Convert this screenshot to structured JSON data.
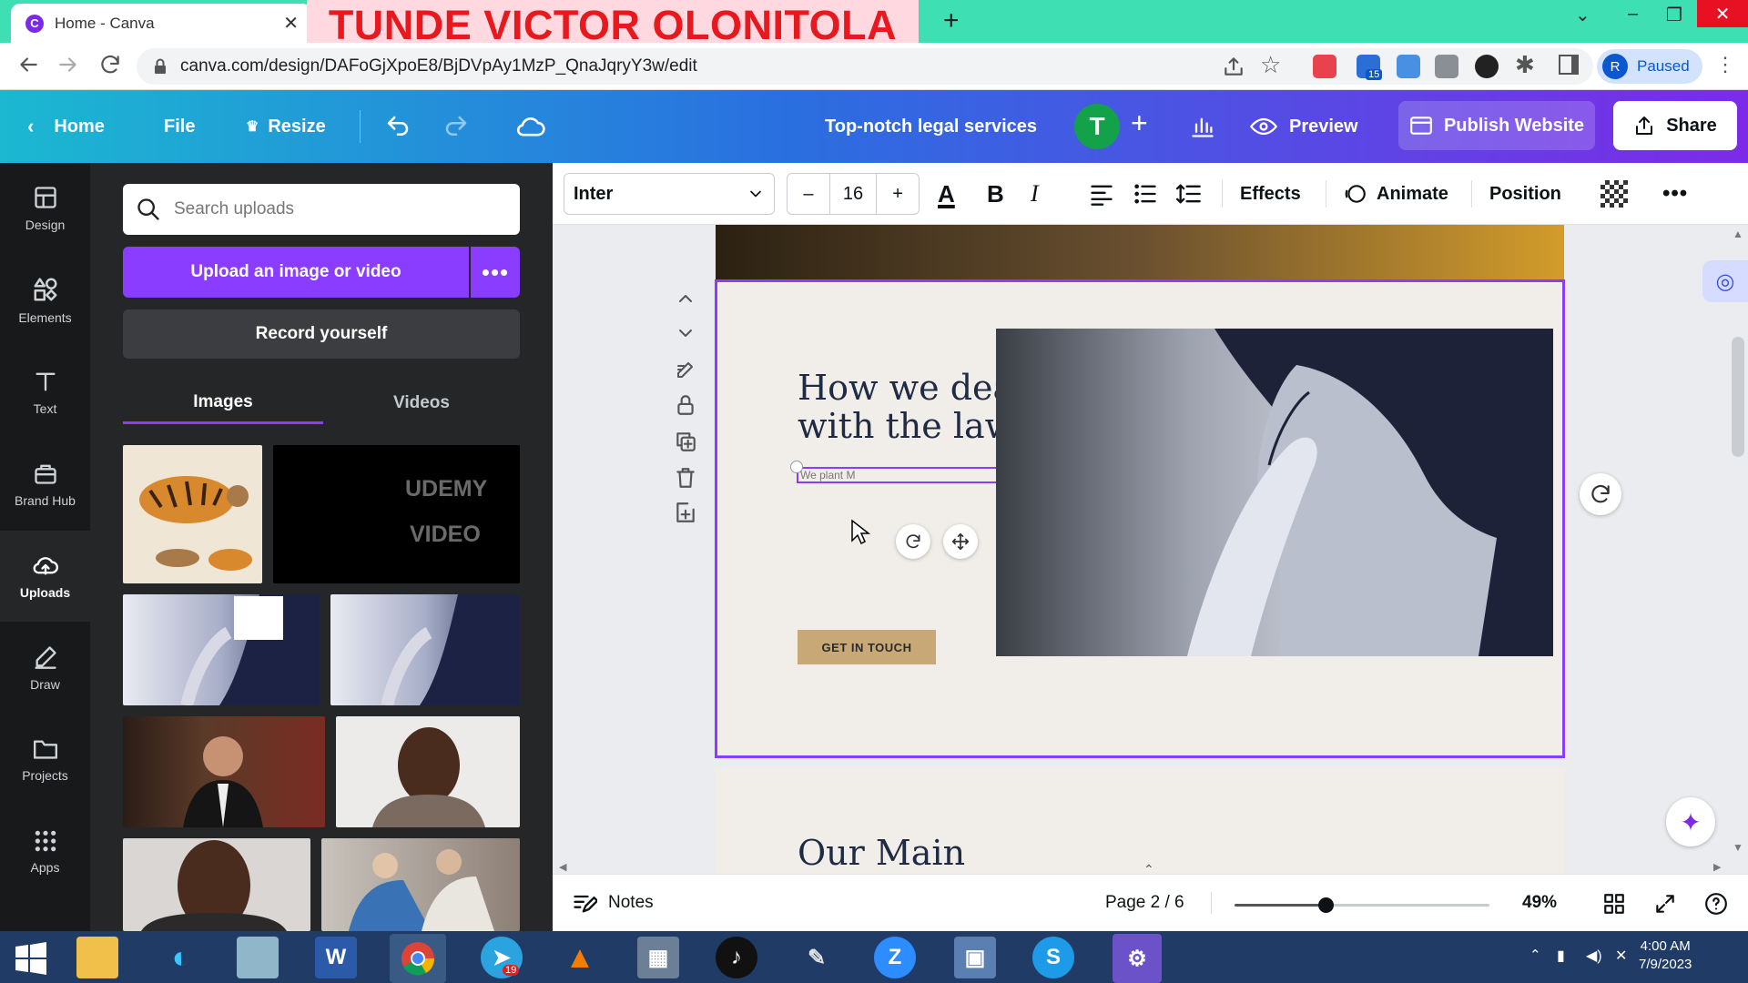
{
  "browser": {
    "tab_title": "Home - Canva",
    "overlay_text": "TUNDE VICTOR OLONITOLA",
    "url": "canva.com/design/DAFoGjXpoE8/BjDVpAy1MzP_QnaJqryY3w/edit",
    "profile_initial": "R",
    "profile_status": "Paused",
    "ext_badge": "15"
  },
  "header": {
    "home": "Home",
    "file": "File",
    "resize": "Resize",
    "design_title": "Top-notch legal services",
    "avatar_initial": "T",
    "preview": "Preview",
    "publish": "Publish Website",
    "share": "Share"
  },
  "rail": [
    {
      "label": "Design",
      "icon": "design-icon"
    },
    {
      "label": "Elements",
      "icon": "elements-icon"
    },
    {
      "label": "Text",
      "icon": "text-icon"
    },
    {
      "label": "Brand Hub",
      "icon": "brand-hub-icon"
    },
    {
      "label": "Uploads",
      "icon": "uploads-icon"
    },
    {
      "label": "Draw",
      "icon": "draw-icon"
    },
    {
      "label": "Projects",
      "icon": "projects-icon"
    },
    {
      "label": "Apps",
      "icon": "apps-icon"
    }
  ],
  "panel": {
    "search_placeholder": "Search uploads",
    "upload_button": "Upload an image or video",
    "record_button": "Record yourself",
    "tab_images": "Images",
    "tab_videos": "Videos",
    "video_thumb_text_1": "UDEMY",
    "video_thumb_text_2": "VIDEO"
  },
  "toolbar": {
    "font": "Inter",
    "font_size": "16",
    "effects": "Effects",
    "animate": "Animate",
    "position": "Position"
  },
  "page": {
    "heading": "How we deal with the law",
    "typed_text": "We plant M",
    "cta": "GET IN TOUCH",
    "next_heading": "Our Main"
  },
  "footer": {
    "notes": "Notes",
    "page_indicator": "Page 2 / 6",
    "zoom": "49%",
    "zoom_level": 0.49
  },
  "taskbar": {
    "badge_telegram": "19",
    "time": "4:00 AM",
    "date": "7/9/2023"
  },
  "colors": {
    "accent": "#8b3dff",
    "tab_strip": "#3ee0b3",
    "overlay_text": "#e8191e",
    "header_start": "#1bb8d1",
    "header_end": "#7d2ae8",
    "cta": "#c9a877",
    "heading_text": "#1f2a44"
  }
}
